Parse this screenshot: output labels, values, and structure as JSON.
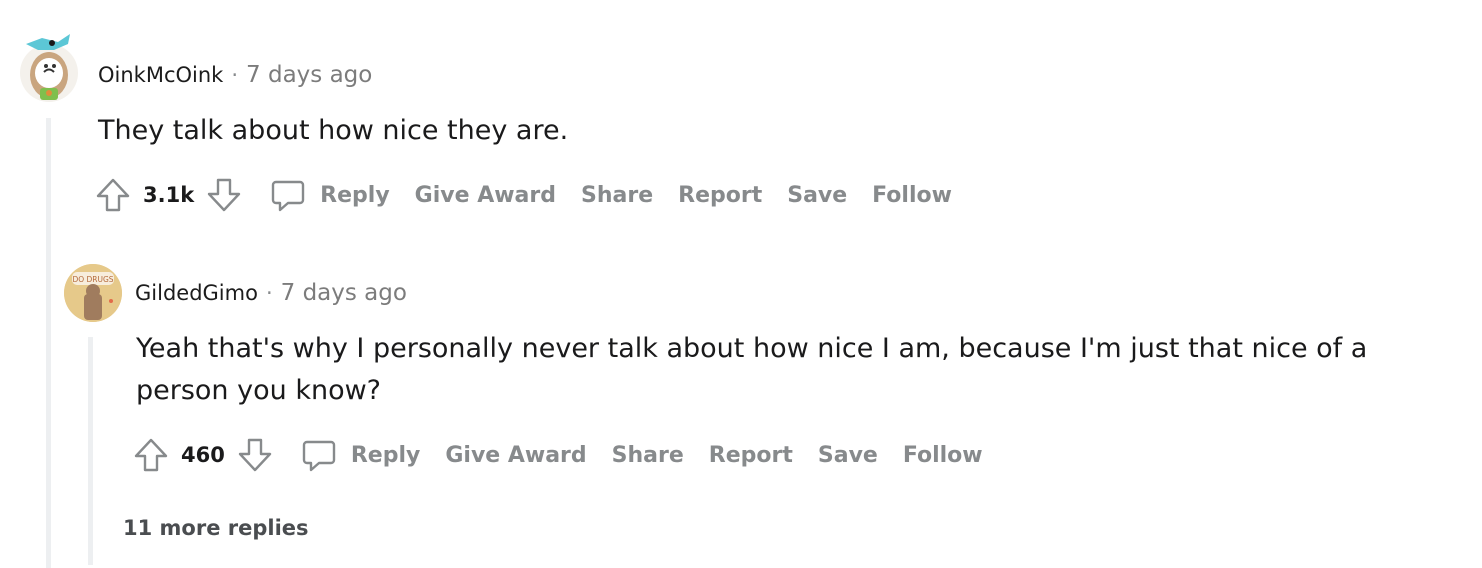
{
  "comments": [
    {
      "username": "OinkMcOink",
      "separator": "·",
      "time": "7 days ago",
      "body_lines": [
        "They talk about how nice they are."
      ],
      "score": "3.1k",
      "actions": {
        "reply": "Reply",
        "give_award": "Give Award",
        "share": "Share",
        "report": "Report",
        "save": "Save",
        "follow": "Follow"
      }
    },
    {
      "username": "GildedGimo",
      "separator": "·",
      "time": "7 days ago",
      "avatar_text": "DO DRUGS",
      "body_lines": [
        "Yeah that's why I personally never talk about how nice I am, because I'm just that nice of a",
        "person you know?"
      ],
      "score": "460",
      "actions": {
        "reply": "Reply",
        "give_award": "Give Award",
        "share": "Share",
        "report": "Report",
        "save": "Save",
        "follow": "Follow"
      }
    }
  ],
  "more_replies": "11 more replies",
  "colors": {
    "muted": "#878a8c",
    "thread_line": "#edeff1",
    "text": "#1a1a1b"
  }
}
